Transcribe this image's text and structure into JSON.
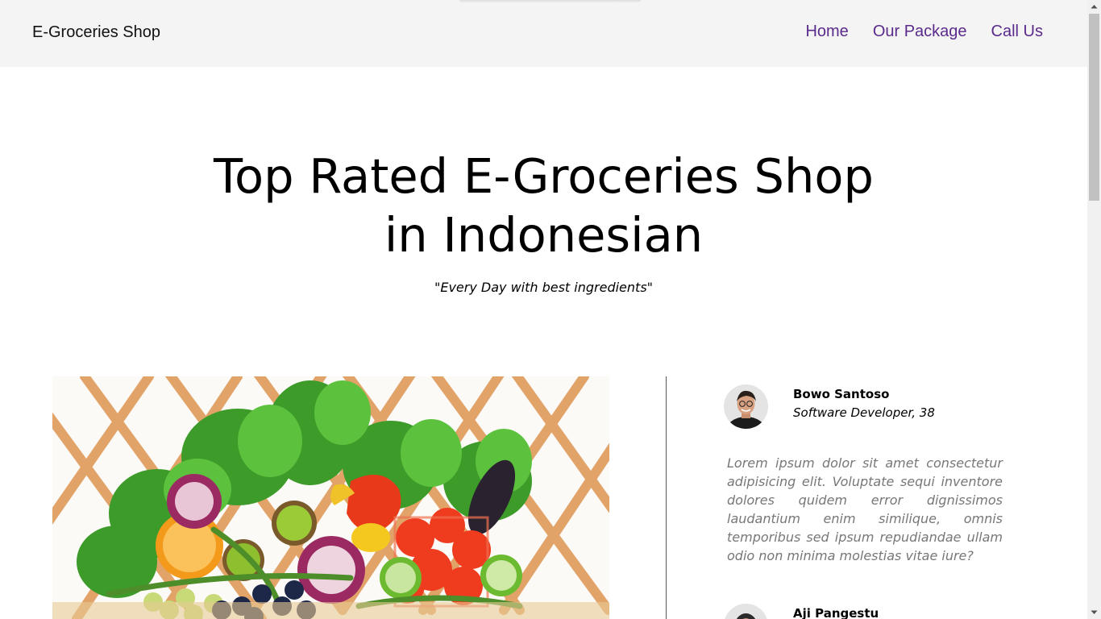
{
  "navbar": {
    "brand": "E-Groceries Shop",
    "links": [
      "Home",
      "Our Package",
      "Call Us"
    ],
    "link_color": "#5a2a8c"
  },
  "hero": {
    "title_line1": "Top Rated E-Groceries Shop",
    "title_line2": "in Indonesian",
    "tagline": "\"Every Day with best ingredients\""
  },
  "testimonials": [
    {
      "name": "Bowo Santoso",
      "role": "Software Developer, 38",
      "quote": "Lorem ipsum dolor sit amet consectetur adipisicing elit. Voluptate sequi inventore dolores quidem error dignissimos laudantium enim similique, omnis temporibus sed ipsum repudiandae ullam odio non minima molestias vitae iure?"
    },
    {
      "name": "Aji Pangestu"
    }
  ]
}
